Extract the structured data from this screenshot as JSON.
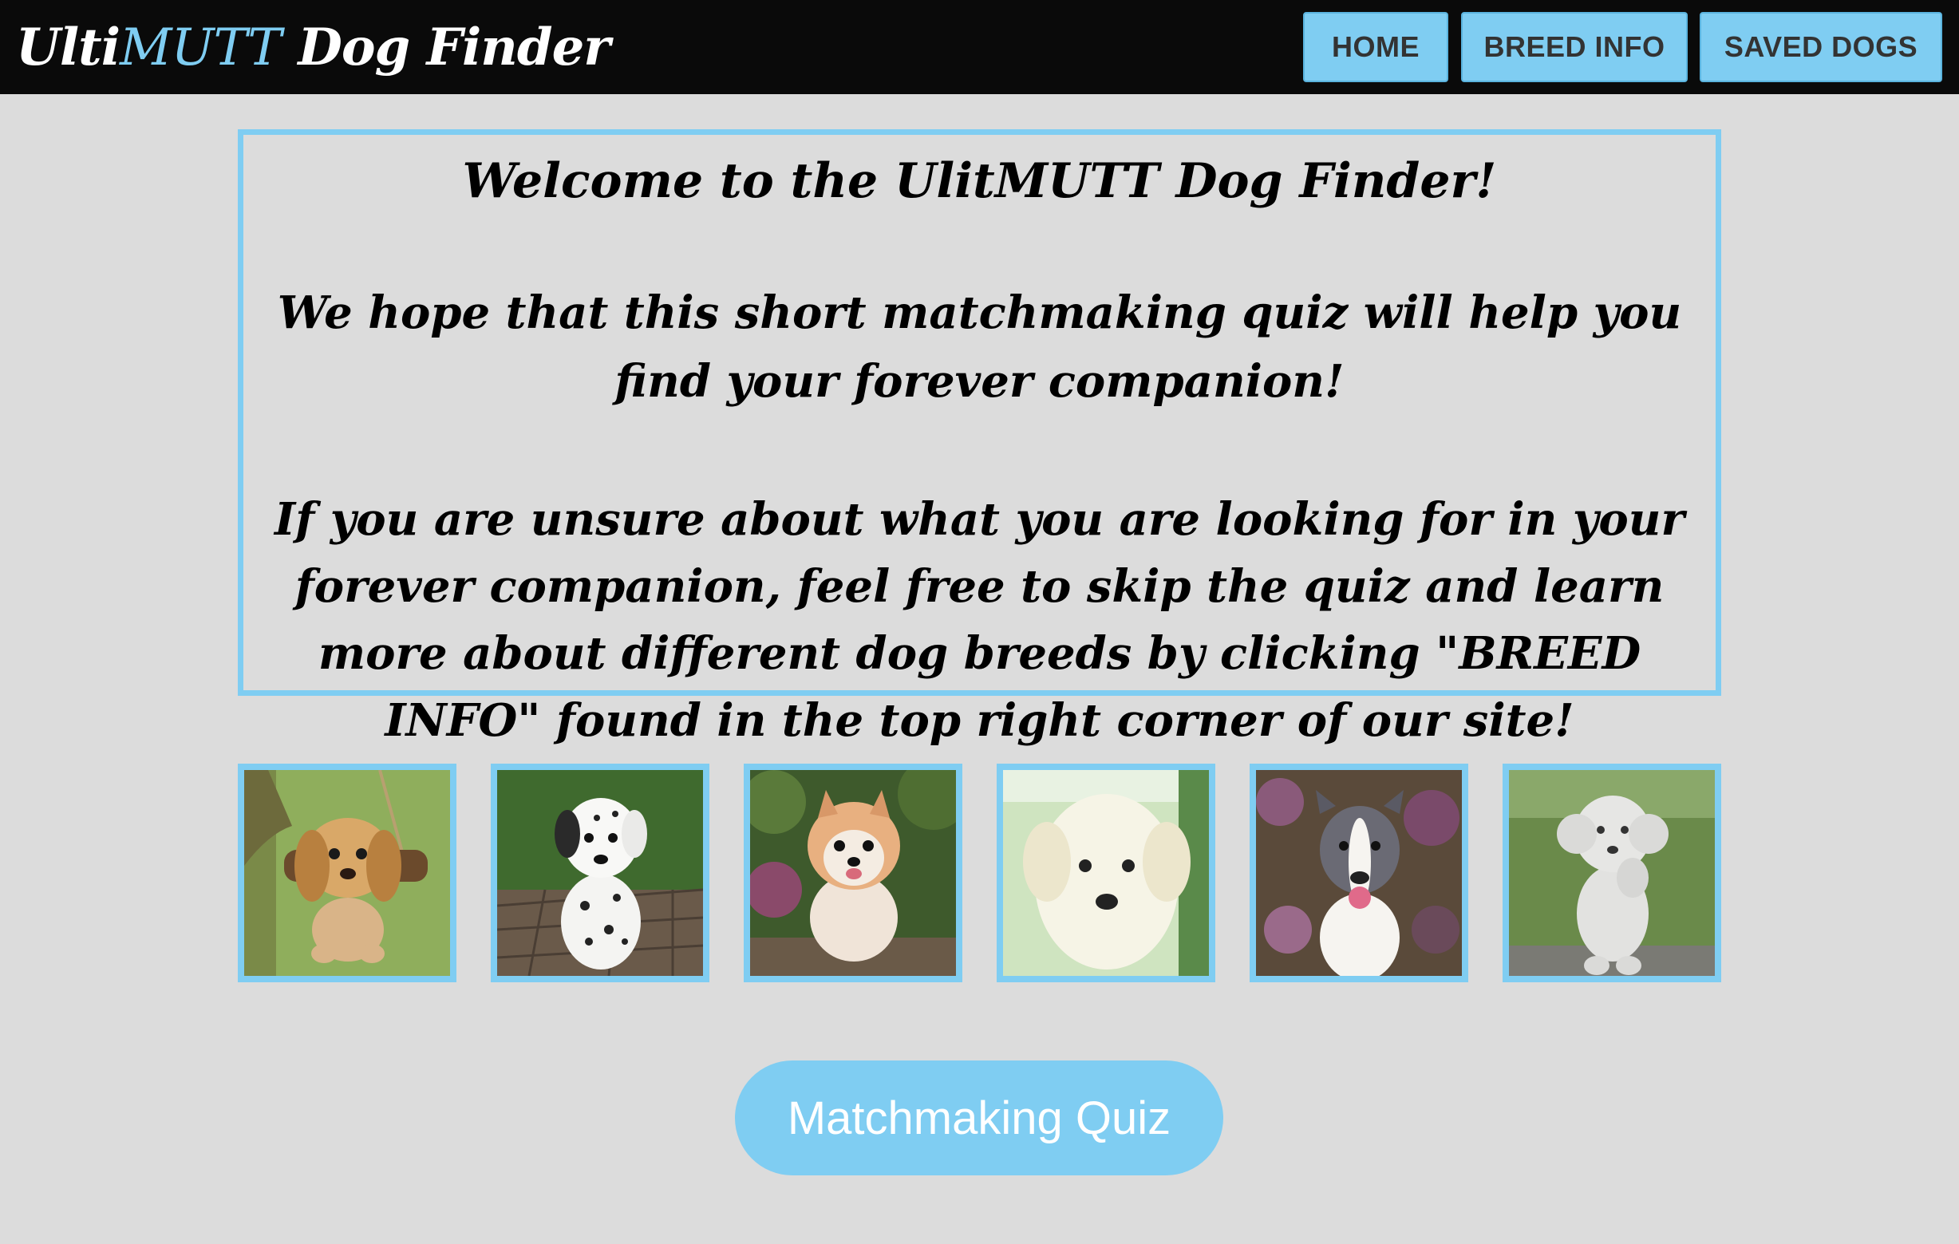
{
  "nav": {
    "brand_prefix": "Ulti",
    "brand_accent": "MUTT",
    "brand_suffix": " Dog Finder",
    "links": [
      "HOME",
      "BREED INFO",
      "SAVED DOGS"
    ]
  },
  "welcome": {
    "title": "Welcome to the UlitMUTT Dog Finder!",
    "line2": "We hope that this short matchmaking quiz will help you find your forever companion!",
    "line3": "If you are unsure about what you are looking for in your forever companion, feel free to skip the quiz and learn more about different dog breeds by clicking \"BREED INFO\" found in the top right corner of our site!"
  },
  "photos": [
    "golden-puppy-swing-photo",
    "dalmatian-puppy-photo",
    "pomeranian-photo",
    "white-puppy-photo",
    "pitbull-photo",
    "white-poodle-statue-photo"
  ],
  "quiz_button": "Matchmaking Quiz",
  "colors": {
    "accent": "#7fcdf2",
    "nav_bg": "#0a0a0a",
    "page_bg": "#dcdcdc",
    "nav_text": "#333333"
  }
}
